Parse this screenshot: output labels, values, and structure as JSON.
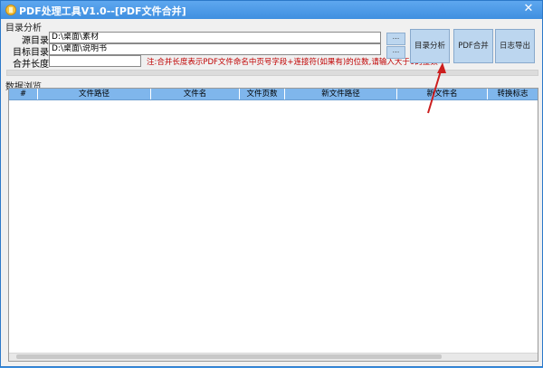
{
  "window": {
    "title": "PDF处理工具V1.0--[PDF文件合并]",
    "close_glyph": "✕"
  },
  "dir_group": {
    "label": "目录分析",
    "source": {
      "label": "源目录",
      "value": "D:\\桌面\\素材"
    },
    "target": {
      "label": "目标目录",
      "value": "D:\\桌面\\说明书"
    },
    "merge_length": {
      "label": "合并长度",
      "value": ""
    },
    "note": "注:合并长度表示PDF文件命名中页号字段+连接符(如果有)的位数,请输入大于0的整数",
    "browse1": "...",
    "browse2": "...",
    "analyze_button": "目录分析",
    "merge_button": "PDF合并",
    "export_log_button": "日志导出"
  },
  "data_group": {
    "label": "数据浏览",
    "columns": [
      "#",
      "文件路径",
      "文件名",
      "文件页数",
      "新文件路径",
      "新文件名",
      "转换标志"
    ]
  },
  "colors": {
    "titlebar": "#3f8fe0",
    "button_bg": "#bcd6ef",
    "header_bg": "#7fb6ec",
    "note_red": "#c00000",
    "arrow_red": "#cc1f1f"
  }
}
